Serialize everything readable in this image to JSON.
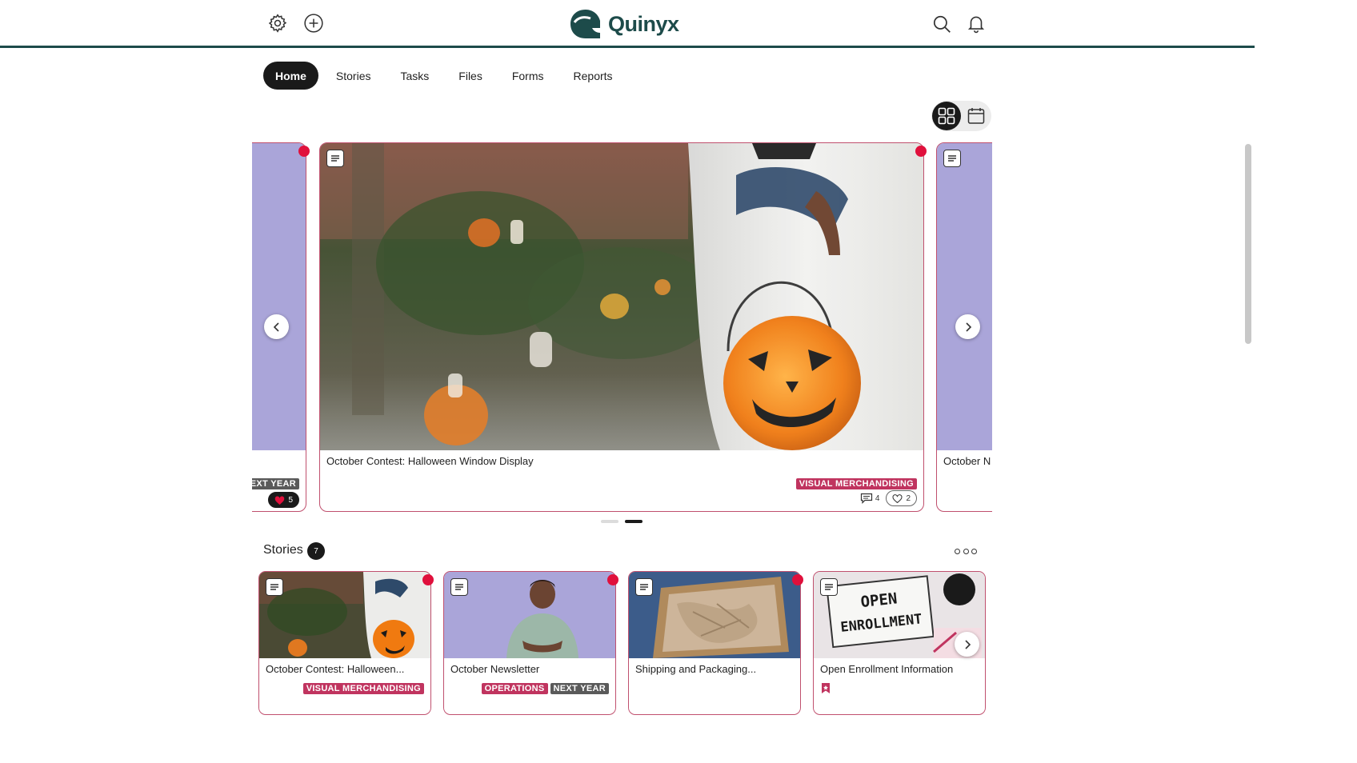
{
  "brand": {
    "name": "Quinyx",
    "color": "#1d4b4a"
  },
  "header": {
    "left_icons": [
      "gear-icon",
      "plus-circle-icon"
    ],
    "right_icons": [
      "search-icon",
      "bell-icon"
    ]
  },
  "nav": {
    "items": [
      {
        "label": "Home",
        "active": true
      },
      {
        "label": "Stories",
        "active": false
      },
      {
        "label": "Tasks",
        "active": false
      },
      {
        "label": "Files",
        "active": false
      },
      {
        "label": "Forms",
        "active": false
      },
      {
        "label": "Reports",
        "active": false
      }
    ]
  },
  "view_toggle": {
    "selected": "grid",
    "options": [
      "grid-icon",
      "calendar-icon"
    ]
  },
  "carousel": {
    "prev_card": {
      "tag": "NEXT YEAR",
      "likes": "5"
    },
    "main_card": {
      "title": "October Contest: Halloween Window Display",
      "tag": "VISUAL MERCHANDISING",
      "comments": "4",
      "likes": "2"
    },
    "next_card": {
      "title": "October N"
    },
    "page_count": 2,
    "active_page": 2
  },
  "stories": {
    "title": "Stories",
    "count": "7",
    "items": [
      {
        "title": "October Contest: Halloween...",
        "tags": [
          "VISUAL MERCHANDISING"
        ],
        "unread": true
      },
      {
        "title": "October Newsletter",
        "tags": [
          "OPERATIONS",
          "NEXT YEAR"
        ],
        "unread": true
      },
      {
        "title": "Shipping and Packaging...",
        "tags": [],
        "unread": true
      },
      {
        "title": "Open Enrollment Information",
        "tags": [],
        "unread": false,
        "bookmarked": true
      }
    ]
  },
  "colors": {
    "accent": "#c0345f",
    "unread_dot": "#e0103c",
    "tag_gray": "#5a5a5a",
    "lavender": "#aaa5d9"
  }
}
